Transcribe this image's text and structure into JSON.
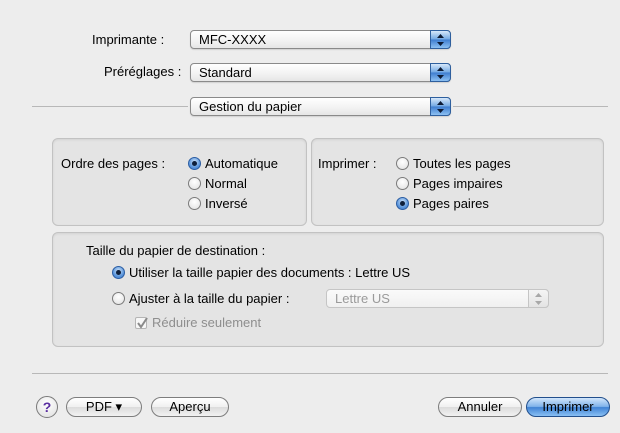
{
  "printer": {
    "label": "Imprimante :",
    "value": "MFC-XXXX"
  },
  "presets": {
    "label": "Préréglages :",
    "value": "Standard"
  },
  "panel_menu": {
    "value": "Gestion du papier"
  },
  "page_order": {
    "label": "Ordre des pages :",
    "options": [
      {
        "label": "Automatique",
        "selected": true
      },
      {
        "label": "Normal",
        "selected": false
      },
      {
        "label": "Inversé",
        "selected": false
      }
    ]
  },
  "print": {
    "label": "Imprimer :",
    "options": [
      {
        "label": "Toutes les pages",
        "selected": false
      },
      {
        "label": "Pages impaires",
        "selected": false
      },
      {
        "label": "Pages paires",
        "selected": true
      }
    ]
  },
  "paper_size": {
    "label": "Taille du papier de destination :",
    "use_document_size": "Utiliser la taille papier des documents : Lettre US",
    "fit_to_paper": "Ajuster à la taille du papier :",
    "fit_paper_value": "Lettre US",
    "reduce_only": "Réduire seulement",
    "reduce_only_checked": true
  },
  "footer": {
    "help": "?",
    "pdf": "PDF ▾",
    "preview": "Aperçu",
    "cancel": "Annuler",
    "print": "Imprimer"
  },
  "colors": {
    "accent": "#3f82d4",
    "background": "#ededed"
  }
}
